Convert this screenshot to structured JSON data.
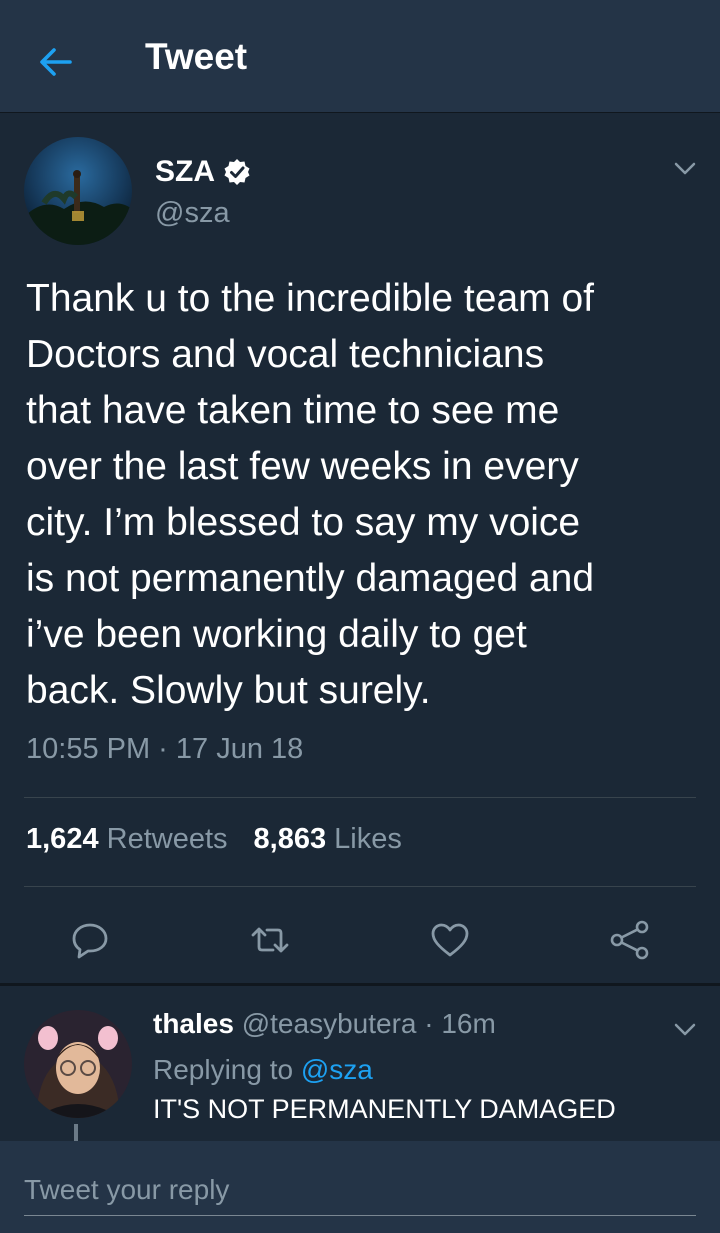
{
  "header": {
    "title": "Tweet"
  },
  "tweet": {
    "name": "SZA",
    "handle": "@sza",
    "text": "Thank u to the incredible team of\nDoctors and vocal technicians\nthat have taken time to see me\nover the last few weeks in every\ncity. I’m blessed to say my voice\nis not permanently damaged and\ni’ve been working daily to get\nback. Slowly but surely.",
    "timestamp": "10:55 PM · 17 Jun 18",
    "retweets_count": "1,624",
    "retweets_label": "Retweets",
    "likes_count": "8,863",
    "likes_label": "Likes"
  },
  "reply": {
    "name": "thales",
    "handle": "@teasybutera",
    "time": "· 16m",
    "replying_prefix": "Replying to",
    "replying_to": "@sza",
    "text": "IT'S NOT PERMANENTLY DAMAGED"
  },
  "composer": {
    "placeholder": "Tweet your reply"
  },
  "colors": {
    "background": "#1b2836",
    "header": "#243447",
    "accent": "#1da1f2",
    "muted": "#8899a6"
  },
  "icons": {
    "back": "arrow-left-icon",
    "verified": "verified-badge-icon",
    "more": "chevron-down-icon",
    "reply": "reply-icon",
    "retweet": "retweet-icon",
    "like": "heart-icon",
    "share": "share-icon"
  }
}
